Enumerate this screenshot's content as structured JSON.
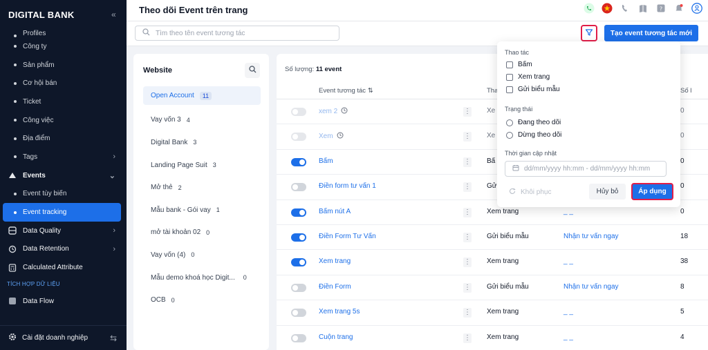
{
  "sidebar": {
    "brand": "DIGITAL BANK",
    "collapse_icon": "«",
    "items": [
      {
        "label": "Profiles"
      },
      {
        "label": "Công ty"
      },
      {
        "label": "Sản phẩm"
      },
      {
        "label": "Cơ hội bán"
      },
      {
        "label": "Ticket"
      },
      {
        "label": "Công việc"
      },
      {
        "label": "Địa điểm"
      },
      {
        "label": "Tags"
      },
      {
        "label": "Events"
      },
      {
        "label": "Event tùy biến"
      },
      {
        "label": "Event tracking"
      },
      {
        "label": "Data Quality"
      },
      {
        "label": "Data Retention"
      },
      {
        "label": "Calculated Attribute"
      },
      {
        "label": "TÍCH HỢP DỮ LIỆU"
      },
      {
        "label": "Data Flow"
      }
    ],
    "bottom_label": "Cài đặt doanh nghiệp"
  },
  "header": {
    "title": "Theo dõi Event trên trang"
  },
  "toolbar": {
    "search_placeholder": "Tìm theo tên event tương tác",
    "create_label": "Tạo event tương tác mới"
  },
  "website_panel": {
    "title": "Website",
    "items": [
      {
        "name": "Open Account",
        "count": "11"
      },
      {
        "name": "Vay vốn 3",
        "count": "4"
      },
      {
        "name": "Digital Bank",
        "count": "3"
      },
      {
        "name": "Landing Page Suit",
        "count": "3"
      },
      {
        "name": "Mở thẻ",
        "count": "2"
      },
      {
        "name": "Mẫu bank - Gói vay",
        "count": "1"
      },
      {
        "name": "mở tài khoản 02",
        "count": "0"
      },
      {
        "name": "Vay vốn (4)",
        "count": "0"
      },
      {
        "name": "Mẫu demo khoá học Digit...",
        "count": "0"
      },
      {
        "name": "OCB",
        "count": "0"
      }
    ]
  },
  "events": {
    "count_label": "Số lượng:",
    "count_value": "11 event",
    "columns": {
      "name": "Event tương tác",
      "type": "Tha",
      "last": "Số l"
    },
    "rows": [
      {
        "name": "xem 2",
        "type": "Xe",
        "target": "",
        "num": "0",
        "state": "dim"
      },
      {
        "name": "Xem",
        "type": "Xe",
        "target": "",
        "num": "0",
        "state": "dim"
      },
      {
        "name": "Bấm",
        "type": "Bấ",
        "target": "",
        "num": "0",
        "state": "on"
      },
      {
        "name": "Điền form tư vấn 1",
        "type": "Gửi",
        "target": "",
        "num": "0",
        "state": "off"
      },
      {
        "name": "Bấm nút A",
        "type": "Xem trang",
        "target": "_ _",
        "num": "0",
        "state": "on"
      },
      {
        "name": "Điền Form Tư Vấn",
        "type": "Gửi biểu mẫu",
        "target": "Nhận tư vấn ngay",
        "num": "18",
        "state": "on"
      },
      {
        "name": "Xem trang",
        "type": "Xem trang",
        "target": "_ _",
        "num": "38",
        "state": "on"
      },
      {
        "name": "Điền Form",
        "type": "Gửi biểu mẫu",
        "target": "Nhận tư vấn ngay",
        "num": "8",
        "state": "off"
      },
      {
        "name": "Xem trang 5s",
        "type": "Xem trang",
        "target": "_ _",
        "num": "5",
        "state": "off"
      },
      {
        "name": "Cuộn trang",
        "type": "Xem trang",
        "target": "_ _",
        "num": "4",
        "state": "off"
      }
    ]
  },
  "filter": {
    "action_label": "Thao tác",
    "actions": [
      "Bấm",
      "Xem trang",
      "Gửi biểu mẫu"
    ],
    "status_label": "Trạng thái",
    "statuses": [
      "Đang theo dõi",
      "Dừng theo dõi"
    ],
    "updated_label": "Thời gian cập nhật",
    "date_placeholder": "dd/mm/yyyy hh:mm - dd/mm/yyyy hh:mm",
    "restore_label": "Khôi phục",
    "cancel_label": "Hủy bỏ",
    "apply_label": "Áp dụng"
  },
  "colors": {
    "accent": "#1d6fe8",
    "sidebar_bg": "#0e1729",
    "highlight": "#e11d48"
  }
}
